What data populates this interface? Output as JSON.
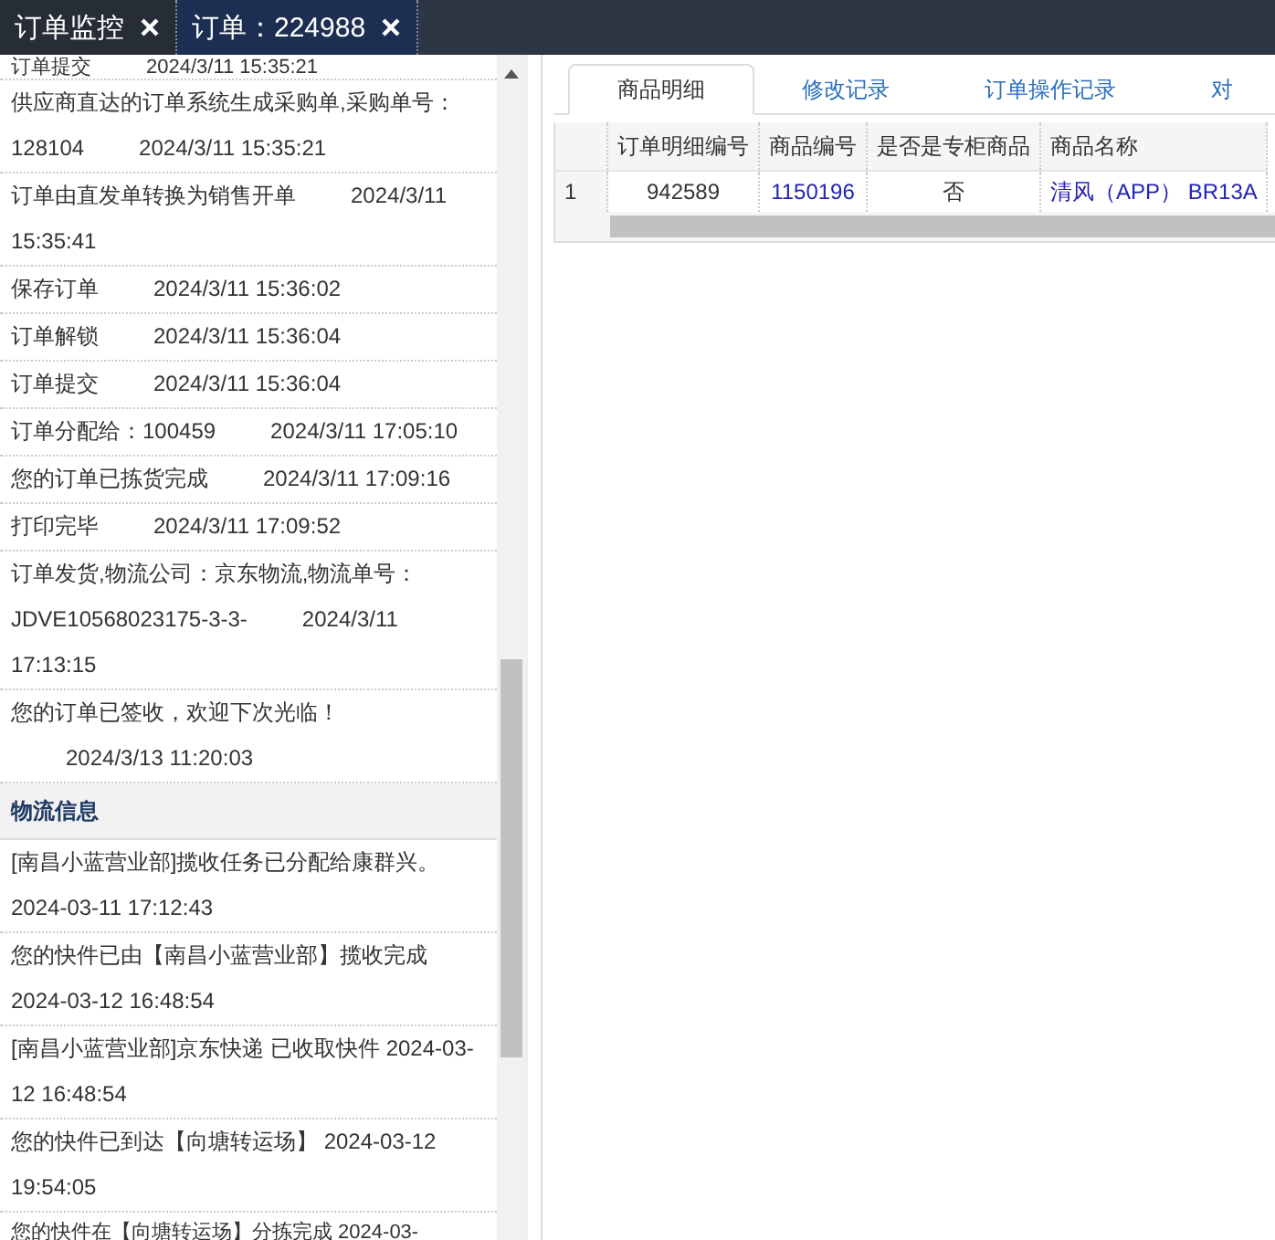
{
  "tabs": [
    {
      "label": "订单监控",
      "selected": false
    },
    {
      "label": "订单：224988",
      "selected": true
    }
  ],
  "order_log": [
    {
      "text": "订单提交",
      "time": "2024/3/11 15:35:21"
    },
    {
      "text": "供应商直达的订单系统生成采购单,采购单号：128104",
      "time": "2024/3/11 15:35:21"
    },
    {
      "text": "订单由直发单转换为销售开单",
      "time": "2024/3/11 15:35:41"
    },
    {
      "text": "保存订单",
      "time": "2024/3/11 15:36:02"
    },
    {
      "text": "订单解锁",
      "time": "2024/3/11 15:36:04"
    },
    {
      "text": "订单提交",
      "time": "2024/3/11 15:36:04"
    },
    {
      "text": "订单分配给：100459",
      "time": "2024/3/11 17:05:10"
    },
    {
      "text": "您的订单已拣货完成",
      "time": "2024/3/11 17:09:16"
    },
    {
      "text": "打印完毕",
      "time": "2024/3/11 17:09:52"
    },
    {
      "text": "订单发货,物流公司：京东物流,物流单号：JDVE10568023175-3-3-",
      "time": "2024/3/11 17:13:15"
    },
    {
      "text": "您的订单已签收，欢迎下次光临！",
      "time": "2024/3/13 11:20:03"
    }
  ],
  "logistics": {
    "title": "物流信息",
    "items": [
      "[南昌小蓝营业部]揽收任务已分配给康群兴。 2024-03-11 17:12:43",
      "您的快件已由【南昌小蓝营业部】揽收完成 2024-03-12 16:48:54",
      "[南昌小蓝营业部]京东快递 已收取快件 2024-03-12 16:48:54",
      "您的快件已到达【向塘转运场】 2024-03-12 19:54:05",
      "您的快件在【向塘转运场】分拣完成 2024-03-"
    ]
  },
  "detail_tabs": [
    {
      "label": "商品明细",
      "selected": true
    },
    {
      "label": "修改记录",
      "selected": false
    },
    {
      "label": "订单操作记录",
      "selected": false
    },
    {
      "label": "对",
      "selected": false
    }
  ],
  "table": {
    "columns": [
      "订单明细编号",
      "商品编号",
      "是否是专柜商品",
      "商品名称"
    ],
    "rows": [
      {
        "index": "1",
        "cells": [
          "942589",
          "1150196",
          "否",
          "清风（APP） BR13A"
        ]
      }
    ]
  }
}
